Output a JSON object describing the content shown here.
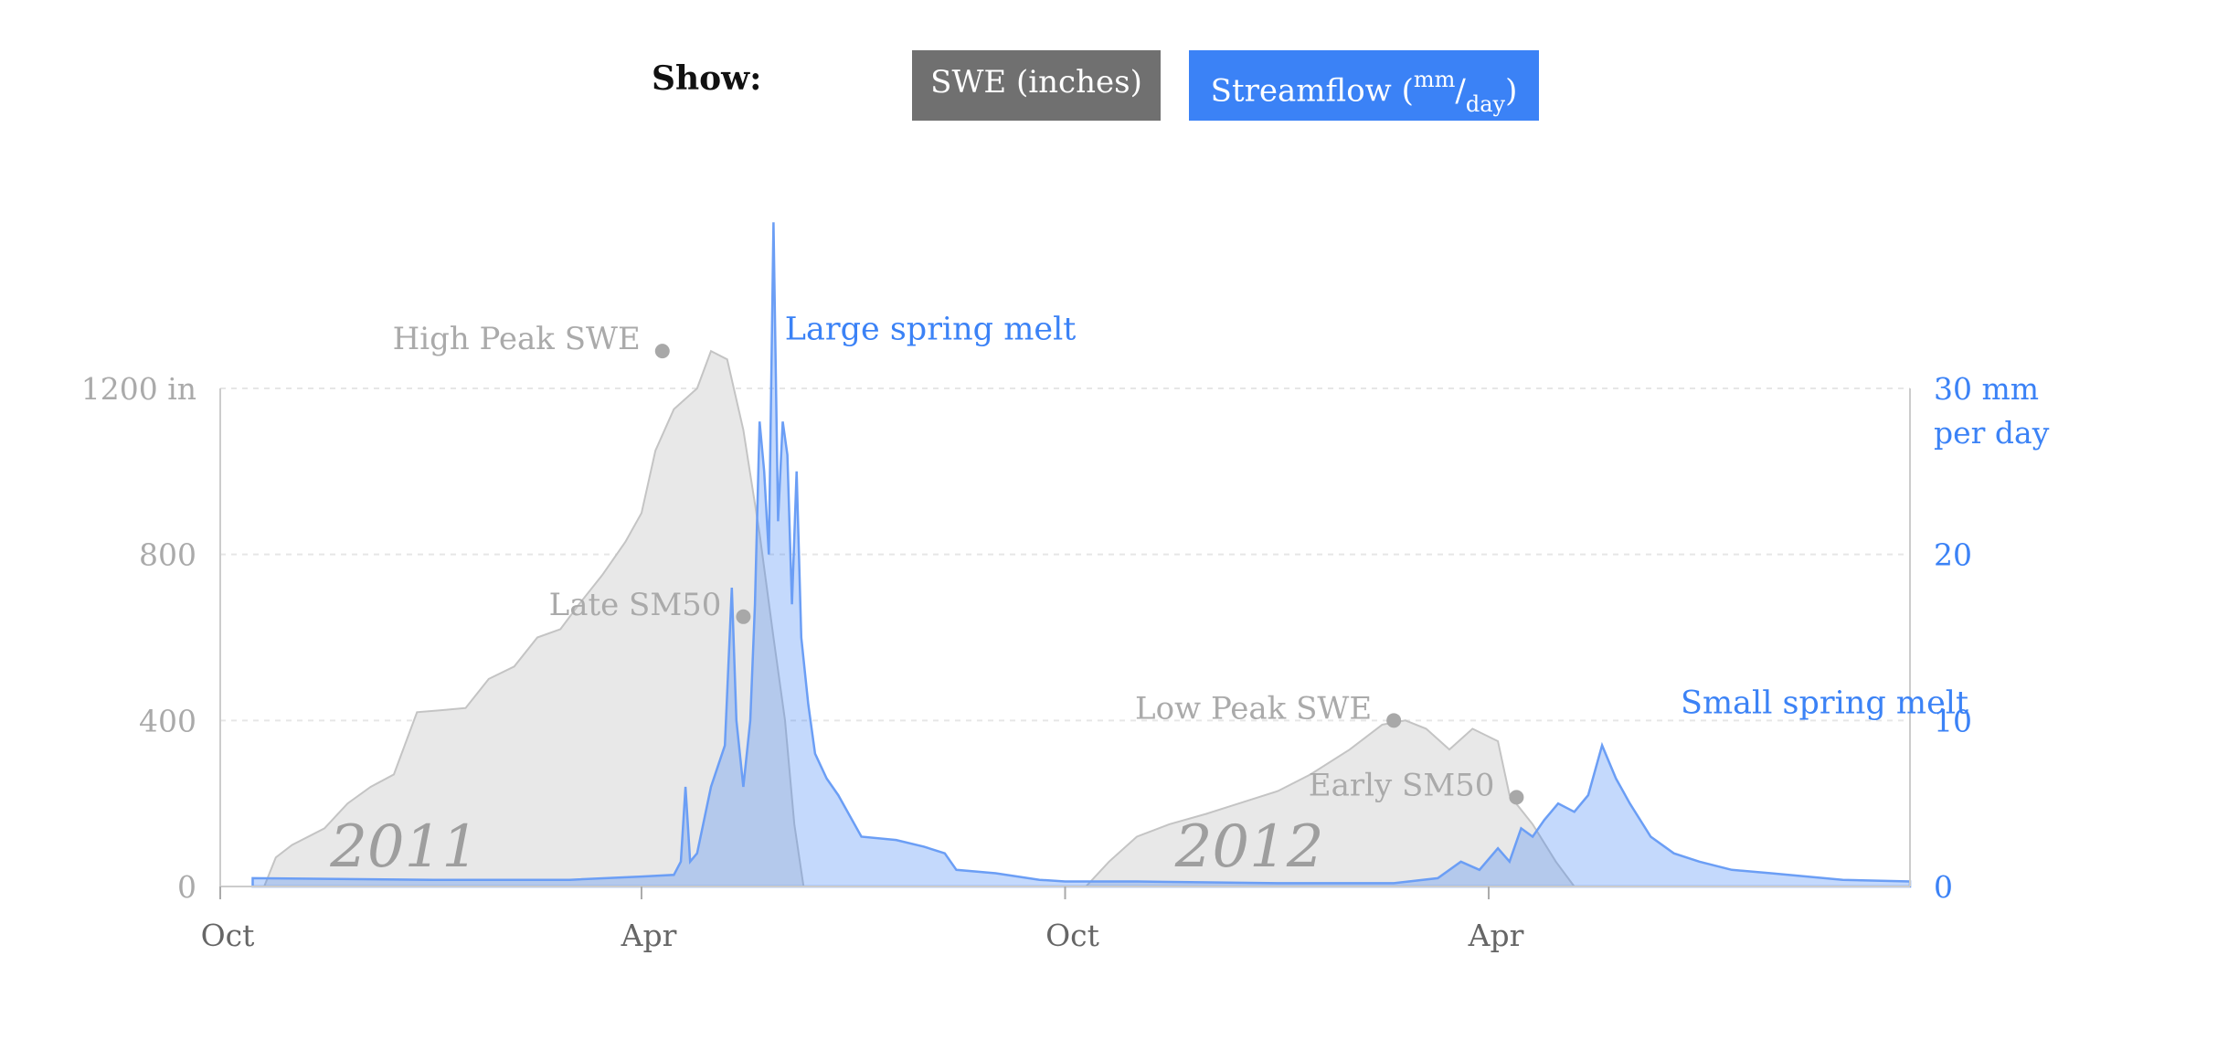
{
  "controls": {
    "show_label": "Show:",
    "swe_button": "SWE (inches)",
    "streamflow_button": {
      "main": "Streamflow (",
      "sup": "mm",
      "slash": "/",
      "sub": "day",
      "close": ")"
    }
  },
  "colors": {
    "swe_fill": "#e8e8e8",
    "swe_stroke": "#c4c4c4",
    "flow_fill": "#3b82f6",
    "flow_stroke": "#6b9ef5",
    "gray_text": "#aaaaaa",
    "blue_text": "#3b82f6",
    "active_button": "#3b82f6",
    "inactive_button": "#707070"
  },
  "chart_data": {
    "type": "area",
    "x_tick_labels": [
      "Oct",
      "Apr",
      "Oct",
      "Apr"
    ],
    "x_range": [
      "2010-10-01",
      "2012-09-30"
    ],
    "y_left": {
      "ticks": [
        0,
        400,
        800,
        1200
      ],
      "tick_labels": [
        "0",
        "400",
        "800",
        "1200 in"
      ],
      "range": [
        0,
        1200
      ]
    },
    "y_right": {
      "ticks": [
        0,
        10,
        20,
        30
      ],
      "tick_labels": [
        "0",
        "10",
        "20",
        "30 mm"
      ],
      "unit_line2": "per day",
      "range": [
        0,
        30
      ]
    },
    "grid": "dashed horizontal",
    "year_labels": [
      {
        "text": "2011",
        "date": "2010-11-20"
      },
      {
        "text": "2012",
        "date": "2011-11-20"
      }
    ],
    "annotations": [
      {
        "text": "High Peak SWE",
        "date": "2011-04-10",
        "value": 1290,
        "axis": "left",
        "marker": true,
        "color": "gray"
      },
      {
        "text": "Large spring melt",
        "date": "2011-05-25",
        "value": 1300,
        "axis": "left",
        "marker": false,
        "color": "blue"
      },
      {
        "text": "Late SM50",
        "date": "2011-05-15",
        "value": 650,
        "axis": "left",
        "marker": true,
        "color": "gray"
      },
      {
        "text": "Low Peak SWE",
        "date": "2012-02-20",
        "value": 400,
        "axis": "left",
        "marker": true,
        "color": "gray"
      },
      {
        "text": "Early SM50",
        "date": "2012-04-13",
        "value": 215,
        "axis": "left",
        "marker": true,
        "color": "gray"
      },
      {
        "text": "Small spring melt",
        "date": "2012-06-15",
        "value": 400,
        "axis": "left",
        "marker": false,
        "color": "blue"
      }
    ],
    "series": [
      {
        "axis": "left",
        "points": [
          [
            "2010-10-20",
            0
          ],
          [
            "2010-10-25",
            70
          ],
          [
            "2010-11-01",
            100
          ],
          [
            "2010-11-15",
            140
          ],
          [
            "2010-11-25",
            200
          ],
          [
            "2010-12-05",
            240
          ],
          [
            "2010-12-15",
            270
          ],
          [
            "2010-12-25",
            420
          ],
          [
            "2011-01-05",
            425
          ],
          [
            "2011-01-15",
            430
          ],
          [
            "2011-01-25",
            500
          ],
          [
            "2011-02-05",
            530
          ],
          [
            "2011-02-15",
            600
          ],
          [
            "2011-02-25",
            620
          ],
          [
            "2011-03-05",
            680
          ],
          [
            "2011-03-15",
            750
          ],
          [
            "2011-03-25",
            830
          ],
          [
            "2011-04-01",
            900
          ],
          [
            "2011-04-07",
            1050
          ],
          [
            "2011-04-15",
            1150
          ],
          [
            "2011-04-25",
            1200
          ],
          [
            "2011-05-01",
            1290
          ],
          [
            "2011-05-08",
            1270
          ],
          [
            "2011-05-15",
            1100
          ],
          [
            "2011-05-22",
            850
          ],
          [
            "2011-05-28",
            600
          ],
          [
            "2011-06-02",
            400
          ],
          [
            "2011-06-06",
            150
          ],
          [
            "2011-06-10",
            0
          ],
          [
            "2011-10-10",
            0
          ],
          [
            "2011-10-20",
            60
          ],
          [
            "2011-11-01",
            120
          ],
          [
            "2011-11-15",
            150
          ],
          [
            "2011-12-01",
            175
          ],
          [
            "2011-12-15",
            200
          ],
          [
            "2012-01-01",
            230
          ],
          [
            "2012-01-15",
            270
          ],
          [
            "2012-02-01",
            330
          ],
          [
            "2012-02-15",
            390
          ],
          [
            "2012-02-25",
            400
          ],
          [
            "2012-03-05",
            380
          ],
          [
            "2012-03-15",
            330
          ],
          [
            "2012-03-25",
            380
          ],
          [
            "2012-04-05",
            350
          ],
          [
            "2012-04-10",
            220
          ],
          [
            "2012-04-20",
            150
          ],
          [
            "2012-04-30",
            60
          ],
          [
            "2012-05-08",
            0
          ]
        ]
      },
      {
        "axis": "right",
        "points": [
          [
            "2010-10-15",
            0.5
          ],
          [
            "2011-01-01",
            0.4
          ],
          [
            "2011-03-01",
            0.4
          ],
          [
            "2011-04-01",
            0.6
          ],
          [
            "2011-04-15",
            0.7
          ],
          [
            "2011-04-18",
            1.5
          ],
          [
            "2011-04-20",
            6.0
          ],
          [
            "2011-04-22",
            1.5
          ],
          [
            "2011-04-25",
            2.0
          ],
          [
            "2011-05-01",
            6.0
          ],
          [
            "2011-05-07",
            8.5
          ],
          [
            "2011-05-10",
            18.0
          ],
          [
            "2011-05-12",
            10.0
          ],
          [
            "2011-05-15",
            6.0
          ],
          [
            "2011-05-18",
            10.0
          ],
          [
            "2011-05-20",
            17.0
          ],
          [
            "2011-05-22",
            28.0
          ],
          [
            "2011-05-24",
            25.0
          ],
          [
            "2011-05-26",
            20.0
          ],
          [
            "2011-05-28",
            40.0
          ],
          [
            "2011-05-30",
            22.0
          ],
          [
            "2011-06-01",
            28.0
          ],
          [
            "2011-06-03",
            26.0
          ],
          [
            "2011-06-05",
            17.0
          ],
          [
            "2011-06-07",
            25.0
          ],
          [
            "2011-06-09",
            15.0
          ],
          [
            "2011-06-12",
            11.0
          ],
          [
            "2011-06-15",
            8.0
          ],
          [
            "2011-06-20",
            6.5
          ],
          [
            "2011-06-25",
            5.5
          ],
          [
            "2011-07-05",
            3.0
          ],
          [
            "2011-07-20",
            2.8
          ],
          [
            "2011-08-01",
            2.4
          ],
          [
            "2011-08-10",
            2.0
          ],
          [
            "2011-08-15",
            1.0
          ],
          [
            "2011-09-01",
            0.8
          ],
          [
            "2011-09-20",
            0.4
          ],
          [
            "2011-10-01",
            0.3
          ],
          [
            "2011-11-01",
            0.3
          ],
          [
            "2012-01-01",
            0.2
          ],
          [
            "2012-02-20",
            0.2
          ],
          [
            "2012-03-10",
            0.5
          ],
          [
            "2012-03-20",
            1.5
          ],
          [
            "2012-03-28",
            1.0
          ],
          [
            "2012-04-05",
            2.3
          ],
          [
            "2012-04-10",
            1.5
          ],
          [
            "2012-04-15",
            3.5
          ],
          [
            "2012-04-20",
            3.0
          ],
          [
            "2012-04-25",
            4.0
          ],
          [
            "2012-05-01",
            5.0
          ],
          [
            "2012-05-08",
            4.5
          ],
          [
            "2012-05-14",
            5.5
          ],
          [
            "2012-05-20",
            8.5
          ],
          [
            "2012-05-26",
            6.5
          ],
          [
            "2012-06-01",
            5.0
          ],
          [
            "2012-06-10",
            3.0
          ],
          [
            "2012-06-20",
            2.0
          ],
          [
            "2012-07-01",
            1.5
          ],
          [
            "2012-07-15",
            1.0
          ],
          [
            "2012-08-01",
            0.8
          ],
          [
            "2012-09-01",
            0.4
          ],
          [
            "2012-09-30",
            0.3
          ]
        ]
      }
    ]
  }
}
